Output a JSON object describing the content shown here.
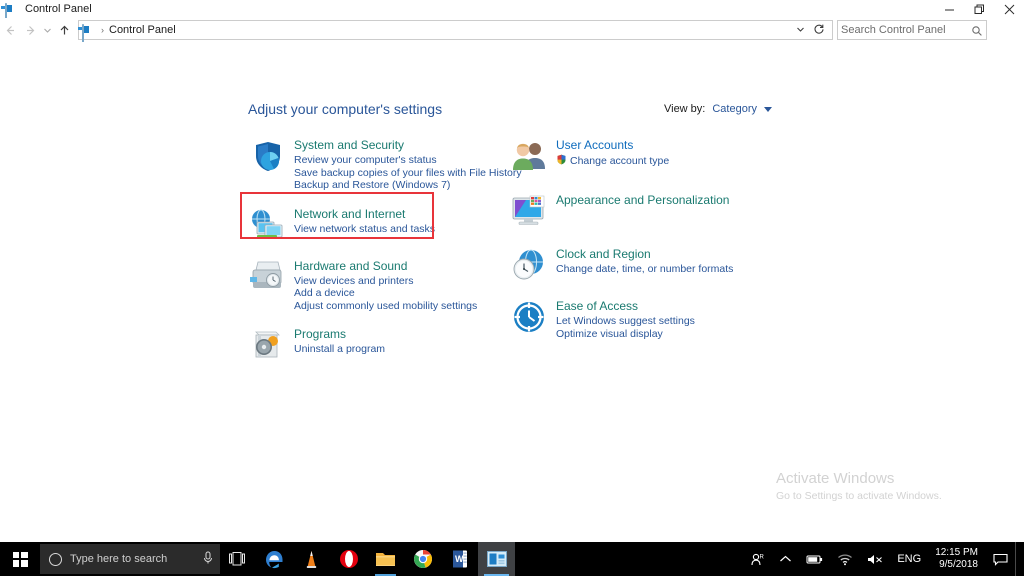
{
  "window": {
    "title": "Control Panel",
    "icon": "control-panel-icon",
    "buttons": {
      "minimize": "─",
      "maximize": "❐",
      "close": "✕"
    }
  },
  "nav": {
    "back": "←",
    "forward": "→",
    "recent": "⌄",
    "up": "↑",
    "address": {
      "icon": "control-panel-icon",
      "separator": "›",
      "text": "Control Panel",
      "chevron": "⌄",
      "refresh": "↻"
    },
    "search": {
      "placeholder": "Search Control Panel",
      "value": "",
      "icon": "search-icon"
    }
  },
  "page": {
    "title": "Adjust your computer's settings",
    "view_by": {
      "label": "View by:",
      "value": "Category",
      "caret": "▼"
    }
  },
  "categories": {
    "left": [
      {
        "icon": "shield-icon",
        "title": "System and Security",
        "title_color": "#1a7a70",
        "links": [
          "Review your computer's status",
          "Save backup copies of your files with File History",
          "Backup and Restore (Windows 7)"
        ]
      },
      {
        "icon": "network-icon",
        "title": "Network and Internet",
        "title_color": "#1a7a70",
        "links": [
          "View network status and tasks"
        ],
        "highlighted": true
      },
      {
        "icon": "printer-icon",
        "title": "Hardware and Sound",
        "title_color": "#1a7a70",
        "links": [
          "View devices and printers",
          "Add a device",
          "Adjust commonly used mobility settings"
        ]
      },
      {
        "icon": "programs-icon",
        "title": "Programs",
        "title_color": "#1a7a70",
        "links": [
          "Uninstall a program"
        ]
      }
    ],
    "right": [
      {
        "icon": "user-accounts-icon",
        "title": "User Accounts",
        "title_color": "#0f6cbd",
        "links": [
          "Change account type"
        ],
        "link_icons": [
          "uac-shield-icon"
        ]
      },
      {
        "icon": "appearance-icon",
        "title": "Appearance and Personalization",
        "title_color": "#1a7a70",
        "links": []
      },
      {
        "icon": "clock-region-icon",
        "title": "Clock and Region",
        "title_color": "#1a7a70",
        "links": [
          "Change date, time, or number formats"
        ]
      },
      {
        "icon": "ease-of-access-icon",
        "title": "Ease of Access",
        "title_color": "#1a7a70",
        "links": [
          "Let Windows suggest settings",
          "Optimize visual display"
        ]
      }
    ]
  },
  "highlight": {
    "color": "#e8343a",
    "target": "Network and Internet"
  },
  "watermark": {
    "line1": "Activate Windows",
    "line2": "Go to Settings to activate Windows."
  },
  "taskbar": {
    "start": "windows-logo-icon",
    "search": {
      "placeholder": "Type here to search",
      "value": "",
      "cortana_icon": "circle-icon",
      "mic_icon": "microphone-icon"
    },
    "task_view": "task-view-icon",
    "apps": [
      {
        "name": "microsoft-edge",
        "label": "e"
      },
      {
        "name": "vlc-media-player",
        "label": "VLC"
      },
      {
        "name": "opera-browser",
        "label": "O"
      },
      {
        "name": "file-explorer",
        "label": "Explorer"
      },
      {
        "name": "google-chrome",
        "label": "Chrome"
      },
      {
        "name": "microsoft-word",
        "label": "W"
      },
      {
        "name": "control-panel",
        "label": "Control Panel"
      }
    ],
    "tray": {
      "people": "people-icon",
      "overflow": "chevron-up-icon",
      "battery": "battery-icon",
      "network": "wifi-icon",
      "volume": "speaker-muted-icon",
      "language": "ENG",
      "time": "12:15 PM",
      "date": "9/5/2018",
      "notifications": "notification-icon"
    }
  }
}
